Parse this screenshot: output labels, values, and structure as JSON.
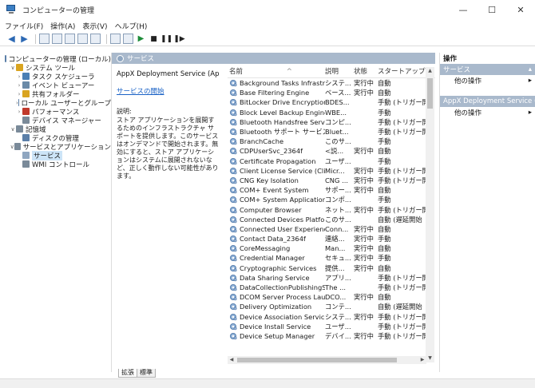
{
  "window": {
    "title": "コンピューターの管理",
    "minimize": "—",
    "maximize": "☐",
    "close": "✕"
  },
  "menu": [
    "ファイル(F)",
    "操作(A)",
    "表示(V)",
    "ヘルプ(H)"
  ],
  "toolbar": {
    "back": "◆",
    "forward": "➜",
    "play": "▶",
    "stop": "■",
    "pause": "❚❚",
    "restart": "❚▶"
  },
  "tree": {
    "items": [
      {
        "label": "コンピューターの管理 (ローカル)",
        "exp": "",
        "level": 0,
        "color": "#5b7fa8",
        "selected": false
      },
      {
        "label": "システム ツール",
        "exp": "∨",
        "level": 1,
        "color": "#d9a420",
        "selected": false
      },
      {
        "label": "タスク スケジューラ",
        "exp": "›",
        "level": 2,
        "color": "#4a7fb5",
        "selected": false
      },
      {
        "label": "イベント ビューアー",
        "exp": "›",
        "level": 2,
        "color": "#6a8aa8",
        "selected": false
      },
      {
        "label": "共有フォルダー",
        "exp": "›",
        "level": 2,
        "color": "#d9a420",
        "selected": false
      },
      {
        "label": "ローカル ユーザーとグループ",
        "exp": "›",
        "level": 2,
        "color": "#5b7fa8",
        "selected": false
      },
      {
        "label": "パフォーマンス",
        "exp": "›",
        "level": 2,
        "color": "#c0392b",
        "selected": false
      },
      {
        "label": "デバイス マネージャー",
        "exp": "",
        "level": 2,
        "color": "#7a8a99",
        "selected": false
      },
      {
        "label": "記憶域",
        "exp": "∨",
        "level": 1,
        "color": "#7a8a99",
        "selected": false
      },
      {
        "label": "ディスクの管理",
        "exp": "",
        "level": 2,
        "color": "#5b7fa8",
        "selected": false
      },
      {
        "label": "サービスとアプリケーション",
        "exp": "∨",
        "level": 1,
        "color": "#7a8a99",
        "selected": false
      },
      {
        "label": "サービス",
        "exp": "",
        "level": 2,
        "color": "#8fa6c0",
        "selected": true
      },
      {
        "label": "WMI コントロール",
        "exp": "",
        "level": 2,
        "color": "#7a8a99",
        "selected": false
      }
    ]
  },
  "center": {
    "header": "サービス",
    "selected_service": "AppX Deployment Service (AppXSVC)",
    "start_link": "サービスの開始",
    "desc_label": "説明:",
    "desc_text": "ストア アプリケーションを展開するためのインフラストラクチャ サポートを提供します。このサービスはオンデマンドで開始されます。無効にすると、ストア アプリケーションはシステムに展開されないなど、正しく動作しない可能性があります。"
  },
  "list": {
    "sort_arrow": "^",
    "columns": {
      "name": "名前",
      "desc": "説明",
      "state": "状態",
      "start": "スタートアップの種"
    },
    "rows": [
      {
        "name": "Background Tasks Infrastruc...",
        "desc": "システ...",
        "state": "実行中",
        "start": "自動"
      },
      {
        "name": "Base Filtering Engine",
        "desc": "ベース...",
        "state": "実行中",
        "start": "自動"
      },
      {
        "name": "BitLocker Drive Encryption ...",
        "desc": "BDES...",
        "state": "",
        "start": "手動 (トリガー開"
      },
      {
        "name": "Block Level Backup Engine ...",
        "desc": "WBE...",
        "state": "",
        "start": "手動"
      },
      {
        "name": "Bluetooth Handsfree Service",
        "desc": "コンピ...",
        "state": "",
        "start": "手動 (トリガー開"
      },
      {
        "name": "Bluetooth サポート サービス",
        "desc": "Bluet...",
        "state": "",
        "start": "手動 (トリガー開"
      },
      {
        "name": "BranchCache",
        "desc": "このサ...",
        "state": "",
        "start": "手動"
      },
      {
        "name": "CDPUserSvc_2364f",
        "desc": "<説...",
        "state": "実行中",
        "start": "自動"
      },
      {
        "name": "Certificate Propagation",
        "desc": "ユーザ...",
        "state": "",
        "start": "手動"
      },
      {
        "name": "Client License Service (ClipS...",
        "desc": "Micr...",
        "state": "実行中",
        "start": "手動 (トリガー開"
      },
      {
        "name": "CNG Key Isolation",
        "desc": "CNG ...",
        "state": "実行中",
        "start": "手動 (トリガー開"
      },
      {
        "name": "COM+ Event System",
        "desc": "サポー...",
        "state": "実行中",
        "start": "自動"
      },
      {
        "name": "COM+ System Application",
        "desc": "コンポ...",
        "state": "",
        "start": "手動"
      },
      {
        "name": "Computer Browser",
        "desc": "ネット...",
        "state": "実行中",
        "start": "手動 (トリガー開"
      },
      {
        "name": "Connected Devices Platfor...",
        "desc": "このサ...",
        "state": "",
        "start": "自動 (遅延開始"
      },
      {
        "name": "Connected User Experience...",
        "desc": "Conn...",
        "state": "実行中",
        "start": "自動"
      },
      {
        "name": "Contact Data_2364f",
        "desc": "連絡...",
        "state": "実行中",
        "start": "手動"
      },
      {
        "name": "CoreMessaging",
        "desc": "Man...",
        "state": "実行中",
        "start": "自動"
      },
      {
        "name": "Credential Manager",
        "desc": "セキュ...",
        "state": "実行中",
        "start": "手動"
      },
      {
        "name": "Cryptographic Services",
        "desc": "提供...",
        "state": "実行中",
        "start": "自動"
      },
      {
        "name": "Data Sharing Service",
        "desc": "アプリ...",
        "state": "",
        "start": "手動 (トリガー開"
      },
      {
        "name": "DataCollectionPublishingSe...",
        "desc": "The ...",
        "state": "",
        "start": "手動 (トリガー開"
      },
      {
        "name": "DCOM Server Process Laun...",
        "desc": "DCO...",
        "state": "実行中",
        "start": "自動"
      },
      {
        "name": "Delivery Optimization",
        "desc": "コンテ...",
        "state": "",
        "start": "自動 (遅延開始"
      },
      {
        "name": "Device Association Service",
        "desc": "システ...",
        "state": "実行中",
        "start": "手動 (トリガー開"
      },
      {
        "name": "Device Install Service",
        "desc": "ユーザ...",
        "state": "",
        "start": "手動 (トリガー開"
      },
      {
        "name": "Device Setup Manager",
        "desc": "デバイ...",
        "state": "実行中",
        "start": "手動 (トリガー開"
      }
    ]
  },
  "tabs": [
    "拡張",
    "標準"
  ],
  "actions": {
    "head": "操作",
    "group1": "サービス",
    "item1": "他の操作",
    "group2": "AppX Deployment Service (...",
    "item2": "他の操作",
    "arrow": "▸",
    "collapse": "▴"
  },
  "colors": {
    "header": "#a9b9cc",
    "link": "#1a62c6",
    "selection": "#cce4f7"
  }
}
